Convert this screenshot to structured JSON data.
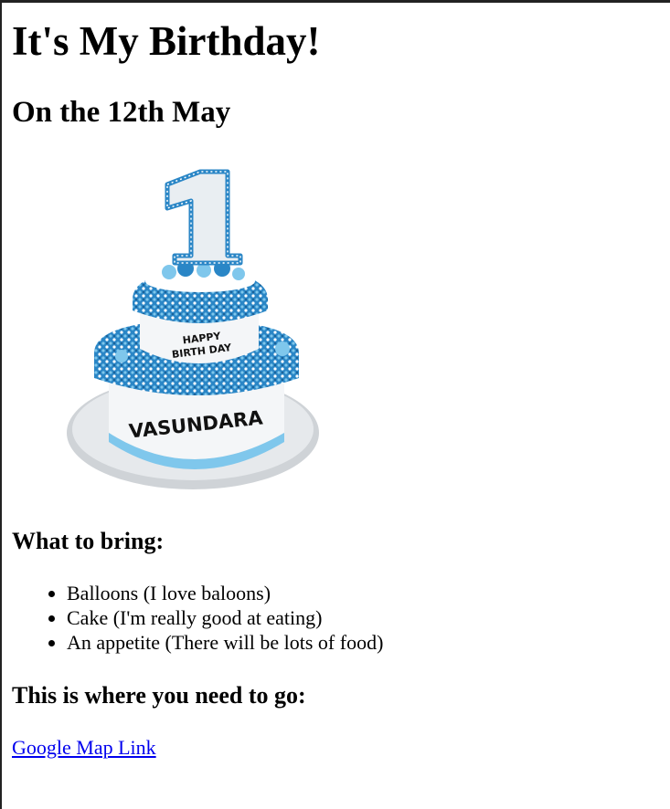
{
  "page": {
    "title": "It's My Birthday!",
    "subtitle": "On the 12th May"
  },
  "image": {
    "subject": "birthday-cake",
    "number_topper": "1",
    "top_tier_text": [
      "HAPPY",
      "BIRTH DAY"
    ],
    "bottom_tier_text": "VASUNDARA",
    "colors": {
      "frosting": "#2a86c6",
      "frosting_light": "#7fc7ec",
      "cream": "#f4f6f8",
      "board": "#cfd3d7"
    }
  },
  "bring": {
    "heading": "What to bring:",
    "items": [
      "Balloons (I love baloons)",
      "Cake (I'm really good at eating)",
      "An appetite (There will be lots of food)"
    ]
  },
  "location": {
    "heading": "This is where you need to go:",
    "link_text": "Google Map Link"
  }
}
